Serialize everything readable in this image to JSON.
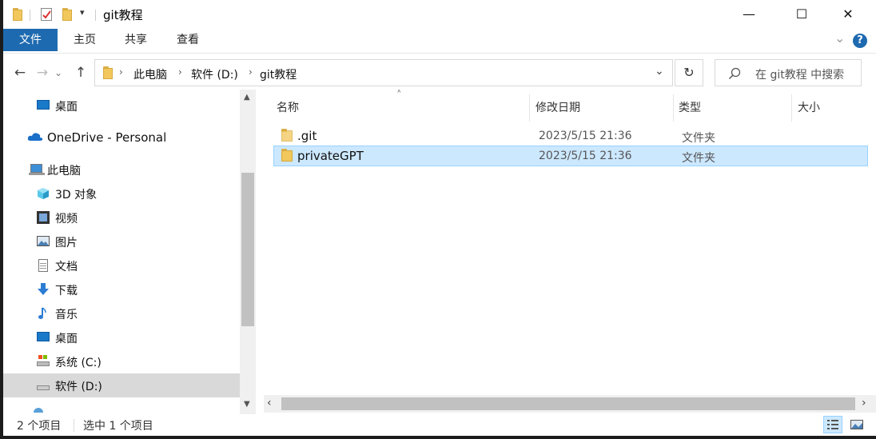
{
  "window": {
    "title": "git教程",
    "minimize_glyph": "—",
    "maximize_glyph": "☐",
    "close_glyph": "✕"
  },
  "ribbon": {
    "tabs": [
      "文件",
      "主页",
      "共享",
      "查看"
    ],
    "help_glyph": "?",
    "expand_glyph": "⌄"
  },
  "nav": {
    "back_glyph": "←",
    "forward_glyph": "→",
    "recent_glyph": "⌄",
    "up_glyph": "↑"
  },
  "address": {
    "crumbs": [
      "此电脑",
      "软件 (D:)",
      "git教程"
    ],
    "sep": "›",
    "dropdown_glyph": "⌄",
    "refresh_glyph": "↻"
  },
  "search": {
    "placeholder": "在 git教程 中搜索",
    "icon": "search-icon"
  },
  "navpane": {
    "items": [
      {
        "label": "桌面",
        "icon": "desktop-icon"
      },
      {
        "label": "OneDrive - Personal",
        "icon": "onedrive-icon"
      },
      {
        "label": "此电脑",
        "icon": "this-pc-icon"
      },
      {
        "label": "3D 对象",
        "icon": "3d-objects-icon"
      },
      {
        "label": "视频",
        "icon": "videos-icon"
      },
      {
        "label": "图片",
        "icon": "pictures-icon"
      },
      {
        "label": "文档",
        "icon": "documents-icon"
      },
      {
        "label": "下载",
        "icon": "downloads-icon"
      },
      {
        "label": "音乐",
        "icon": "music-icon"
      },
      {
        "label": "桌面",
        "icon": "desktop-icon"
      },
      {
        "label": "系统 (C:)",
        "icon": "drive-c-icon"
      },
      {
        "label": "软件 (D:)",
        "icon": "drive-d-icon"
      }
    ],
    "selected": "软件 (D:)"
  },
  "filelist": {
    "columns": [
      "名称",
      "修改日期",
      "类型",
      "大小"
    ],
    "sort_glyph": "˄",
    "rows": [
      {
        "name": ".git",
        "date": "2023/5/15 21:36",
        "type": "文件夹",
        "size": ""
      },
      {
        "name": "privateGPT",
        "date": "2023/5/15 21:36",
        "type": "文件夹",
        "size": ""
      }
    ],
    "selected_row": "privateGPT"
  },
  "statusbar": {
    "item_count": "2 个项目",
    "selection": "选中 1 个项目"
  },
  "colors": {
    "accent": "#1e6ab0",
    "selection_bg": "#cce8ff",
    "selection_border": "#99d1ff",
    "nav_selected": "#d9d9d9",
    "folder_yellow": "#f2c75c"
  }
}
